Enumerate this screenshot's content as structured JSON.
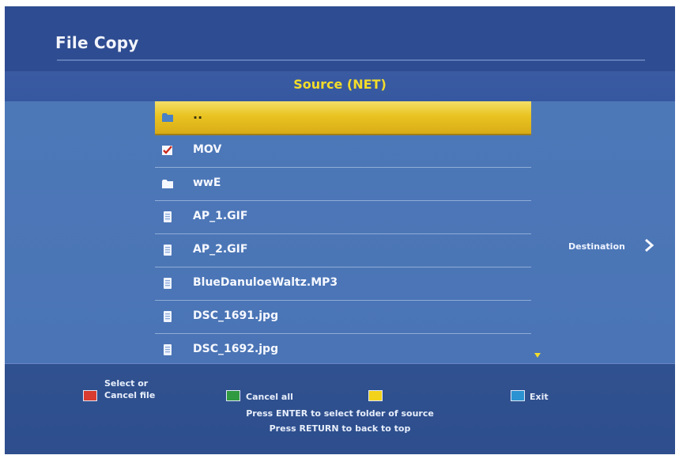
{
  "header": {
    "title": "File Copy"
  },
  "panel": {
    "source_title": "Source (NET)",
    "destination_label": "Destination",
    "destination_arrow": ">"
  },
  "files": [
    {
      "label": "..",
      "icon": "folder-icon",
      "selected": true
    },
    {
      "label": "MOV",
      "icon": "checked-icon",
      "selected": false
    },
    {
      "label": "wwE",
      "icon": "folder-icon",
      "selected": false
    },
    {
      "label": "AP_1.GIF",
      "icon": "file-icon",
      "selected": false
    },
    {
      "label": "AP_2.GIF",
      "icon": "file-icon",
      "selected": false
    },
    {
      "label": "BlueDanuloeWaltz.MP3",
      "icon": "file-icon",
      "selected": false
    },
    {
      "label": "DSC_1691.jpg",
      "icon": "file-icon",
      "selected": false
    },
    {
      "label": "DSC_1692.jpg",
      "icon": "file-icon",
      "selected": false
    }
  ],
  "footer": {
    "red": {
      "color": "#d93b30",
      "label_line1": "Select or",
      "label_line2": "Cancel file"
    },
    "green": {
      "color": "#2f9a3f",
      "label": "Cancel all"
    },
    "yellow": {
      "color": "#f2d21b",
      "label": ""
    },
    "blue": {
      "color": "#2b93d1",
      "label": "Exit"
    },
    "hint1": "Press ENTER to select folder of source",
    "hint2": "Press RETURN to back to top"
  },
  "colors": {
    "accent_yellow": "#f3dc2a",
    "selected_row": "#e9c321",
    "list_bg": "#4a74b5",
    "page_bg": "#2e4c91"
  }
}
